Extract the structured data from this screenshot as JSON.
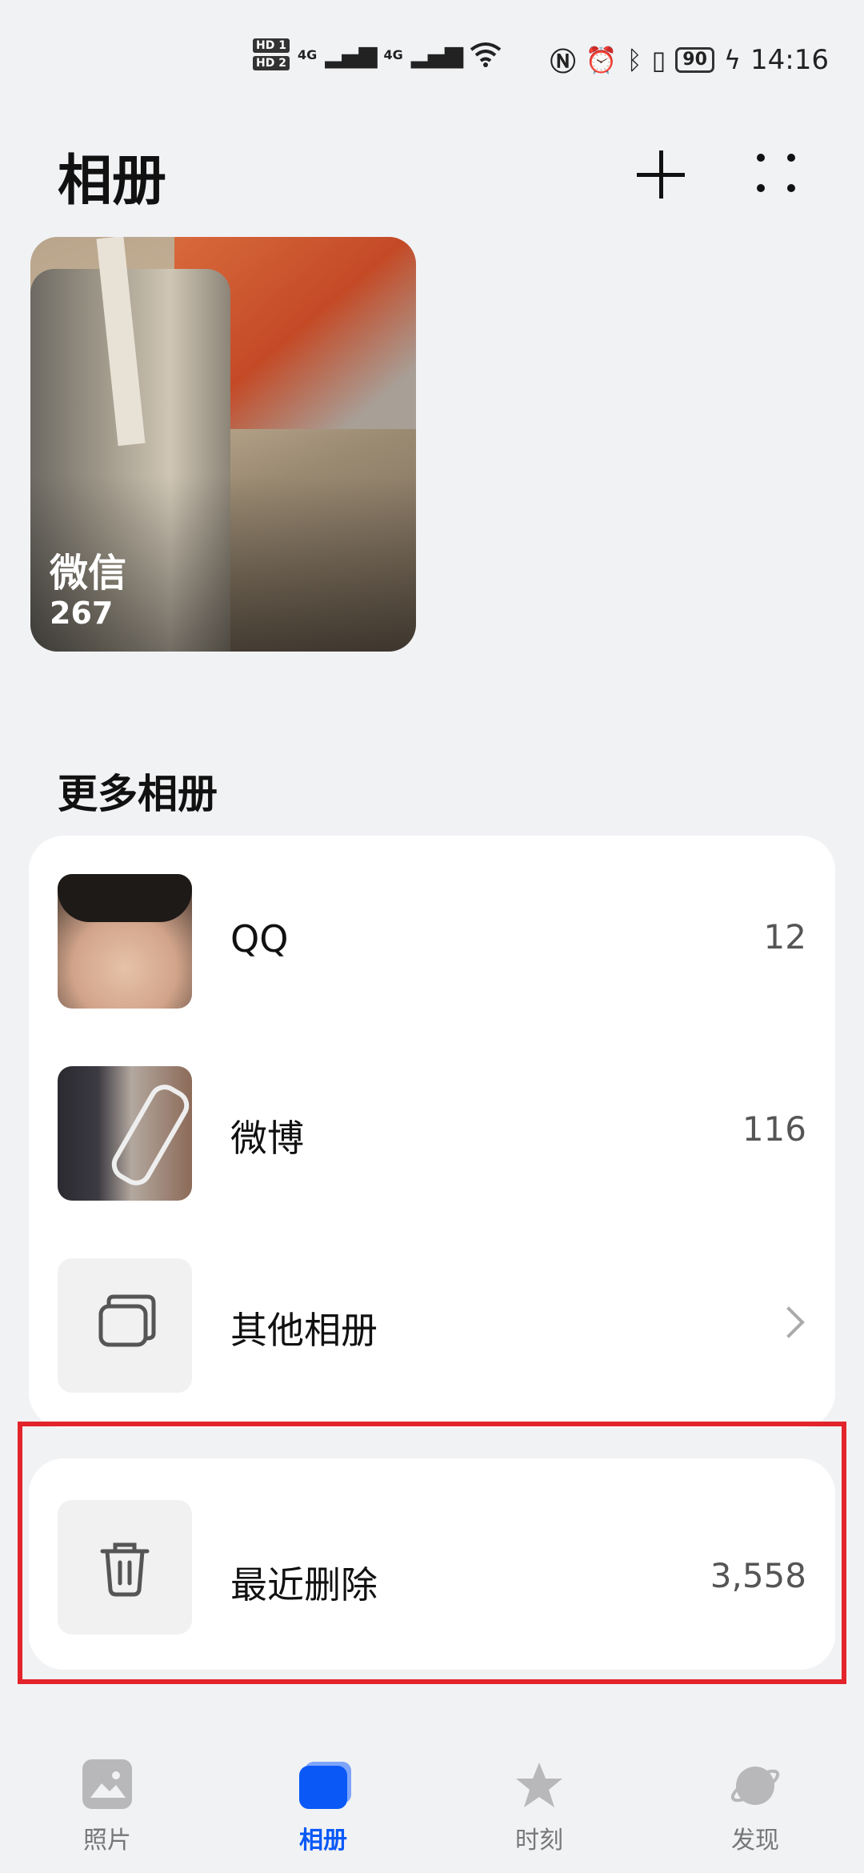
{
  "status_bar": {
    "hd1": "HD 1",
    "hd2": "HD 2",
    "network1": "4G",
    "network2": "4G",
    "battery": "90",
    "time": "14:16"
  },
  "header": {
    "title": "相册"
  },
  "featured_album": {
    "name": "微信",
    "count": "267"
  },
  "more_albums": {
    "section_title": "更多相册",
    "items": [
      {
        "label": "QQ",
        "count": "12"
      },
      {
        "label": "微博",
        "count": "116"
      },
      {
        "label": "其他相册",
        "count": ""
      }
    ]
  },
  "recently_deleted": {
    "label": "最近删除",
    "count": "3,558"
  },
  "bottom_nav": {
    "items": [
      {
        "label": "照片"
      },
      {
        "label": "相册"
      },
      {
        "label": "时刻"
      },
      {
        "label": "发现"
      }
    ],
    "active_color": "#0a59f7"
  },
  "highlight_color": "#e3242b"
}
